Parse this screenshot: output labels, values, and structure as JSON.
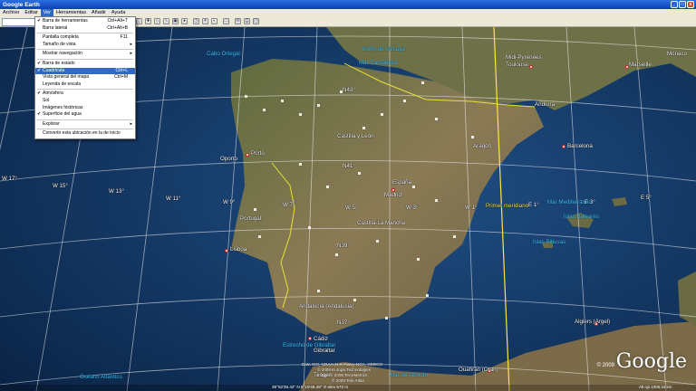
{
  "window": {
    "title": "Google Earth",
    "controls": [
      "_",
      "□",
      "x"
    ]
  },
  "menubar": [
    "Archivo",
    "Editar",
    "Ver",
    "Herramientas",
    "Añadir",
    "Ayuda"
  ],
  "ver_menu": [
    {
      "label": "Barra de herramientas",
      "shortcut": "Ctrl+Alt+T",
      "checked": true
    },
    {
      "label": "Barra lateral",
      "shortcut": "Ctrl+Alt+B"
    },
    {
      "sep": true
    },
    {
      "label": "Pantalla completa",
      "shortcut": "F11"
    },
    {
      "label": "Tamaño de vista",
      "submenu": true
    },
    {
      "sep": true
    },
    {
      "label": "Mostrar navegación",
      "submenu": true
    },
    {
      "sep": true
    },
    {
      "label": "Barra de estado",
      "checked": true
    },
    {
      "label": "Cuadrícula",
      "shortcut": "Ctrl+L",
      "checked": true,
      "highlighted": true
    },
    {
      "label": "Vista general del mapa",
      "shortcut": "Ctrl+M"
    },
    {
      "label": "Leyenda de escala"
    },
    {
      "sep": true
    },
    {
      "label": "Atmósfera",
      "checked": true
    },
    {
      "label": "Sol"
    },
    {
      "label": "Imágenes históricas"
    },
    {
      "label": "Superficie del agua",
      "checked": true
    },
    {
      "sep": true
    },
    {
      "label": "Explorar",
      "submenu": true
    },
    {
      "sep": true
    },
    {
      "label": "Convertir esta ubicación en la de inicio"
    }
  ],
  "map": {
    "sea_labels": [
      "Golfo de Vizcaya",
      "Mar Cantábrico",
      "Cabo Ortegal",
      "Mar Mediterráneo",
      "Islas Baleares",
      "Islas Pitiusas",
      "Estrecho de Gibraltar",
      "Mar de Alborán",
      "Océano Atlántico"
    ],
    "place_labels": [
      "Midi-Pyrénées",
      "Toulouse",
      "Marseille",
      "Mónaco",
      "Andorra",
      "Aragón",
      "Barcelona",
      "Castilla y León",
      "Oporto",
      "Porto",
      "España",
      "Madrid",
      "Portugal",
      "Castilla-La Mancha",
      "Lisboa",
      "Andalucía (Andalusia)",
      "Cádiz",
      "Gibraltar",
      "Tanger",
      "Ouahran (Oran)",
      "Algiers (Argel)"
    ],
    "grid_labels": [
      "N43°",
      "N41°",
      "N39°",
      "N37°",
      "W 17°",
      "W 15°",
      "W 13°",
      "W 11°",
      "W 9°",
      "W 7°",
      "W 5°",
      "W 3°",
      "W 1°",
      "E 1°",
      "E 3°",
      "E 5°"
    ],
    "meridian_label": "Primer meridiano",
    "attribution": [
      "Data SIO, NOAA, U.S. Navy, NGA, GEBCO",
      "© 2009 Europa Technologies",
      "Image © 2009 TerraMetrics",
      "© 2009 Tele Atlas"
    ],
    "copyright": "© 2009",
    "logo": "Google",
    "status": "39°52'36.42\" N   5°10'48.28\" O   elev  573 m",
    "altitude": "Alt ojo 1006.34 km"
  }
}
